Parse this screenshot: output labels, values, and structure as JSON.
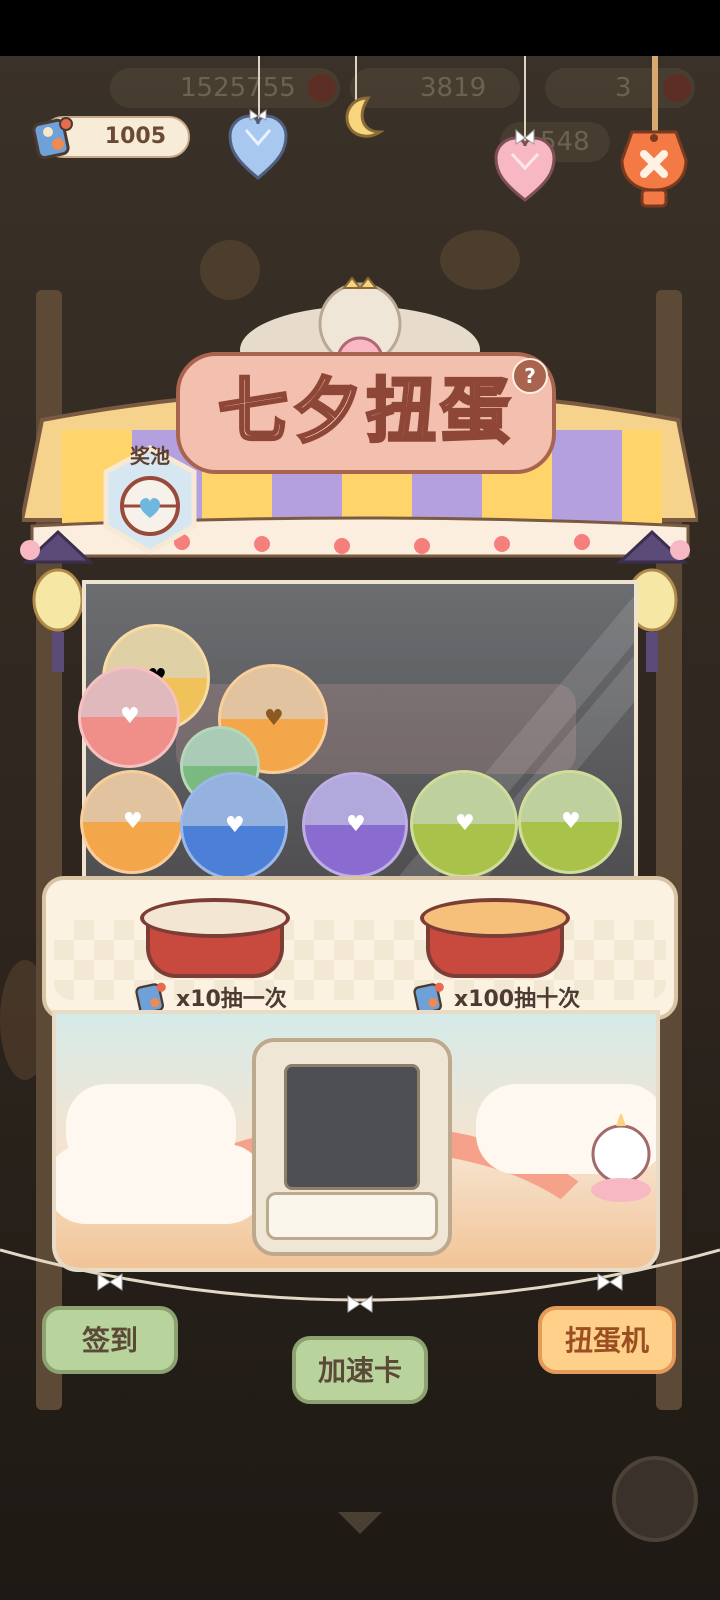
{
  "currency": {
    "tickets": "1005"
  },
  "background_hud": {
    "coins": "1525755",
    "fish": "3819",
    "item3": "3",
    "secondary": "548"
  },
  "machine": {
    "title": "七夕扭蛋",
    "help": "?",
    "prize_pool_label": "奖池"
  },
  "draw_options": [
    {
      "label": "x10抽一次"
    },
    {
      "label": "x100抽十次"
    }
  ],
  "bottom_nav": {
    "sign_in": "签到",
    "speed_card": "加速卡",
    "gacha": "扭蛋机"
  },
  "colors": {
    "accent": "#f2a38c",
    "title_text": "#8e4637",
    "green_button": "#b9d39c",
    "orange_button": "#ffd08a"
  }
}
